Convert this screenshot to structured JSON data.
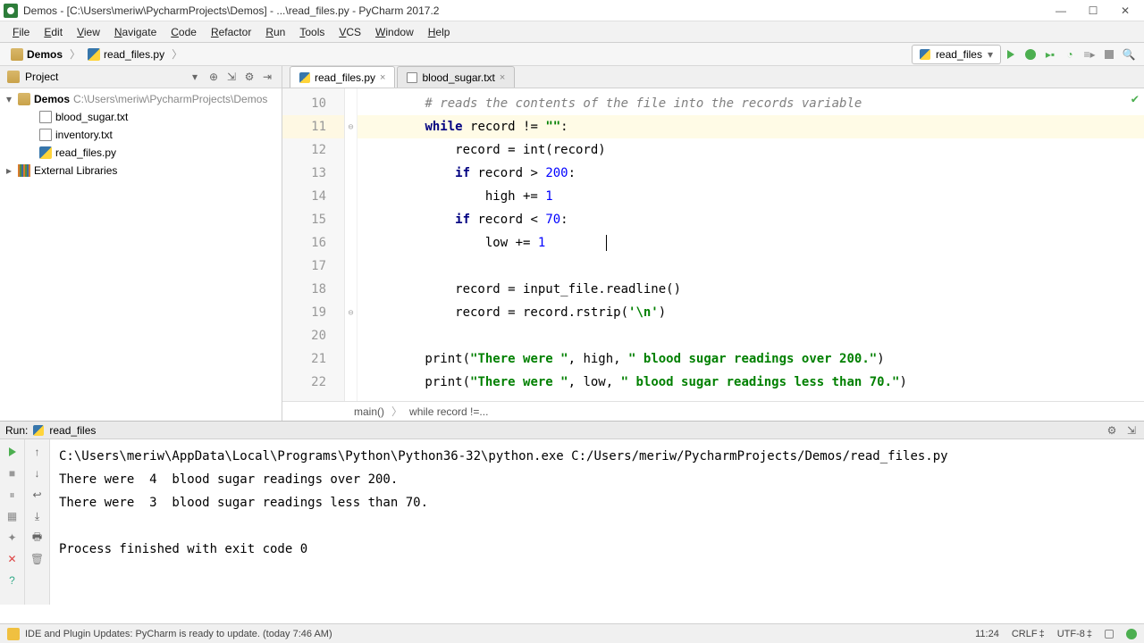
{
  "window": {
    "title": "Demos - [C:\\Users\\meriw\\PycharmProjects\\Demos] - ...\\read_files.py - PyCharm 2017.2"
  },
  "menu": [
    "File",
    "Edit",
    "View",
    "Navigate",
    "Code",
    "Refactor",
    "Run",
    "Tools",
    "VCS",
    "Window",
    "Help"
  ],
  "breadcrumb": {
    "root": "Demos",
    "file": "read_files.py"
  },
  "run_config": {
    "label": "read_files"
  },
  "project_panel": {
    "header": "Project",
    "root_name": "Demos",
    "root_path": "C:\\Users\\meriw\\PycharmProjects\\Demos",
    "files": [
      "blood_sugar.txt",
      "inventory.txt",
      "read_files.py"
    ],
    "external": "External Libraries"
  },
  "editor": {
    "tabs": [
      {
        "label": "read_files.py",
        "icon": "py",
        "active": true
      },
      {
        "label": "blood_sugar.txt",
        "icon": "txt",
        "active": false
      }
    ],
    "first_line": 10,
    "current_line": 11,
    "breadcrumb": [
      "main()",
      "while record !=..."
    ],
    "lines": [
      {
        "n": 10,
        "t": "comment",
        "text": "        # reads the contents of the file into the records variable"
      },
      {
        "n": 11,
        "t": "code",
        "html": "        <span class='c-kw'>while</span> record != <span class='c-str'>\"\"</span>:"
      },
      {
        "n": 12,
        "t": "code",
        "html": "            record = int(record)"
      },
      {
        "n": 13,
        "t": "code",
        "html": "            <span class='c-kw'>if</span> record &gt; <span class='c-num'>200</span>:"
      },
      {
        "n": 14,
        "t": "code",
        "html": "                high += <span class='c-num'>1</span>"
      },
      {
        "n": 15,
        "t": "code",
        "html": "            <span class='c-kw'>if</span> record &lt; <span class='c-num'>70</span>:"
      },
      {
        "n": 16,
        "t": "code",
        "html": "                low += <span class='c-num'>1</span>        <span class='cursor-caret'></span>"
      },
      {
        "n": 17,
        "t": "code",
        "html": ""
      },
      {
        "n": 18,
        "t": "code",
        "html": "            record = input_file.readline()"
      },
      {
        "n": 19,
        "t": "code",
        "html": "            record = record.rstrip(<span class='c-str'>'\\n'</span>)"
      },
      {
        "n": 20,
        "t": "code",
        "html": ""
      },
      {
        "n": 21,
        "t": "code",
        "html": "        print(<span class='c-str'>\"There were \"</span>, high, <span class='c-str'>\" blood sugar readings over 200.\"</span>)"
      },
      {
        "n": 22,
        "t": "code",
        "html": "        print(<span class='c-str'>\"There were \"</span>, low, <span class='c-str'>\" blood sugar readings less than 70.\"</span>)"
      }
    ]
  },
  "run_tool": {
    "header_label": "Run:",
    "config_name": "read_files",
    "output": "C:\\Users\\meriw\\AppData\\Local\\Programs\\Python\\Python36-32\\python.exe C:/Users/meriw/PycharmProjects/Demos/read_files.py\nThere were  4  blood sugar readings over 200.\nThere were  3  blood sugar readings less than 70.\n\nProcess finished with exit code 0"
  },
  "status": {
    "message": "IDE and Plugin Updates: PyCharm is ready to update. (today 7:46 AM)",
    "pos": "11:24",
    "sep": "CRLF",
    "enc": "UTF-8"
  }
}
